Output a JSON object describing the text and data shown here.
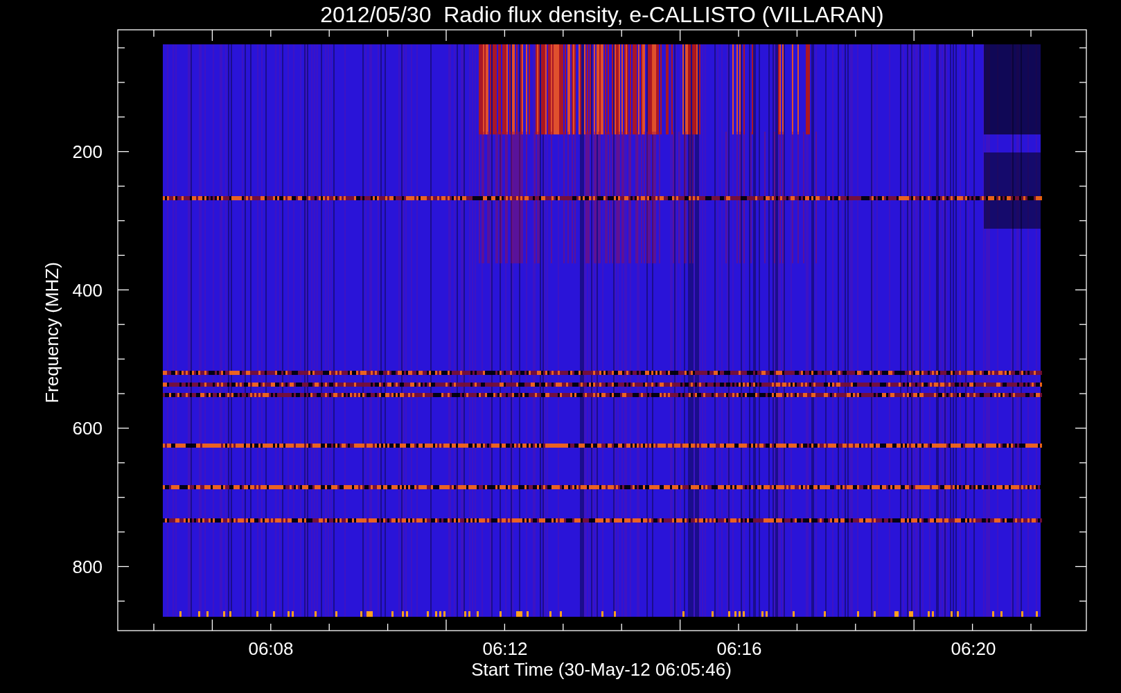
{
  "plot": {
    "title": "2012/05/30  Radio flux density, e-CALLISTO (VILLARAN)",
    "ylabel": "Frequency (MHZ)",
    "xlabel": "Start Time (30-May-12 06:05:46)",
    "ytick_labels": [
      "200",
      "400",
      "600",
      "800"
    ],
    "xtick_labels": [
      "06:08",
      "06:12",
      "06:16",
      "06:20"
    ]
  }
}
